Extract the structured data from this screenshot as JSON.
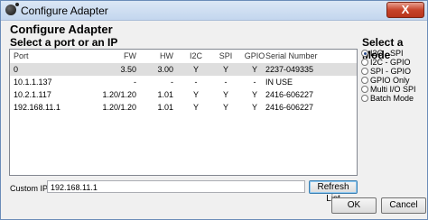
{
  "window": {
    "title": "Configure Adapter",
    "close_glyph": "X"
  },
  "headings": {
    "configure": "Configure Adapter",
    "select_port": "Select a port or an IP",
    "select_mode": "Select a Mode"
  },
  "table": {
    "columns": [
      "Port",
      "FW",
      "HW",
      "I2C",
      "SPI",
      "GPIO",
      "Serial Number"
    ],
    "rows": [
      {
        "port": "0",
        "fw": "3.50",
        "hw": "3.00",
        "i2c": "Y",
        "spi": "Y",
        "gpio": "Y",
        "serial": "2237-049335",
        "selected": true
      },
      {
        "port": "10.1.1.137",
        "fw": "-",
        "hw": "-",
        "i2c": "-",
        "spi": "-",
        "gpio": "-",
        "serial": "IN USE",
        "selected": false
      },
      {
        "port": "10.2.1.117",
        "fw": "1.20/1.20",
        "hw": "1.01",
        "i2c": "Y",
        "spi": "Y",
        "gpio": "Y",
        "serial": "2416-606227",
        "selected": false
      },
      {
        "port": "192.168.11.1",
        "fw": "1.20/1.20",
        "hw": "1.01",
        "i2c": "Y",
        "spi": "Y",
        "gpio": "Y",
        "serial": "2416-606227",
        "selected": false
      }
    ]
  },
  "modes": [
    {
      "label": "I2C - SPI",
      "selected": true
    },
    {
      "label": "I2C - GPIO",
      "selected": false
    },
    {
      "label": "SPI - GPIO",
      "selected": false
    },
    {
      "label": "GPIO Only",
      "selected": false
    },
    {
      "label": "Multi I/O SPI",
      "selected": false
    },
    {
      "label": "Batch Mode",
      "selected": false
    }
  ],
  "custom_ips": {
    "label": "Custom IPs",
    "value": "192.168.11.1"
  },
  "buttons": {
    "refresh": "Refresh List",
    "ok": "OK",
    "cancel": "Cancel"
  },
  "colors": {
    "selected_row": "#dedede",
    "close_button": "#c7442b",
    "titlebar": "#c3d6ee"
  }
}
